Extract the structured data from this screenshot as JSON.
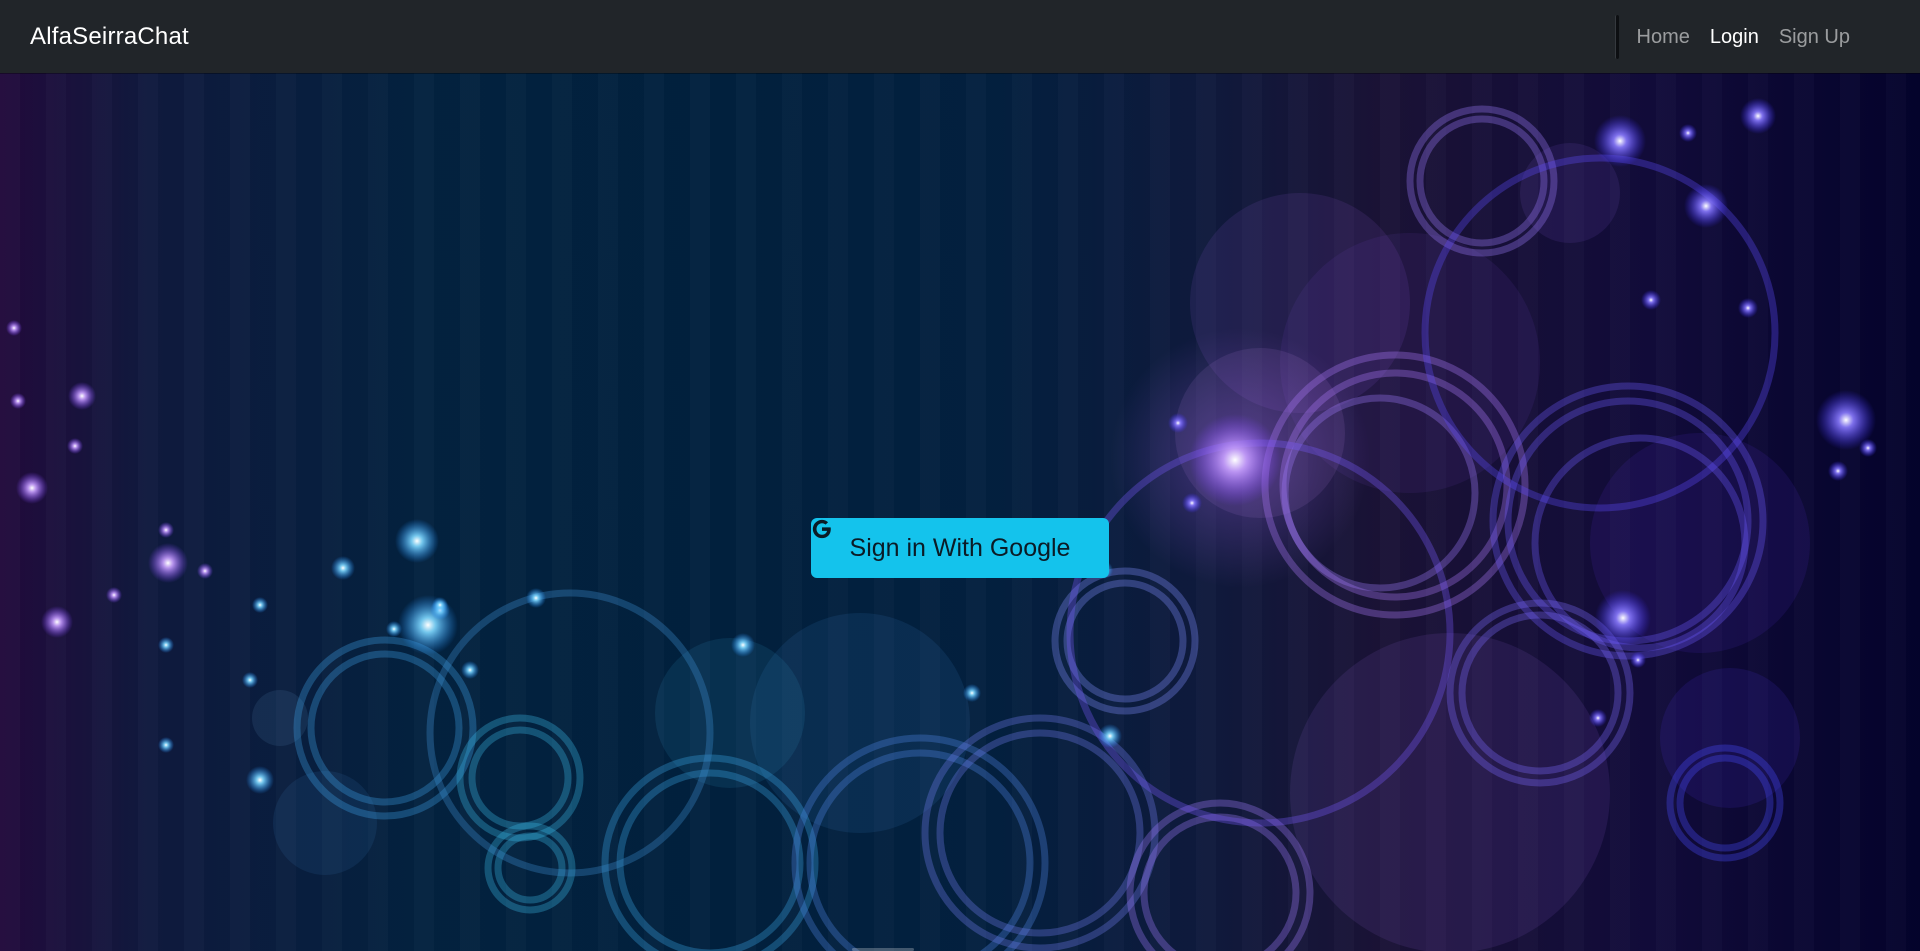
{
  "navbar": {
    "brand": "AlfaSeirraChat",
    "links": [
      {
        "label": "Home",
        "active": false
      },
      {
        "label": "Login",
        "active": true
      },
      {
        "label": "Sign Up",
        "active": false
      }
    ]
  },
  "main": {
    "signin_button": {
      "label": "Sign in With Google",
      "icon": "google-g-icon",
      "color": "#14c3ec"
    }
  },
  "theme": {
    "navbar_bg": "#212529",
    "background": "bokeh-circles-gradient"
  }
}
